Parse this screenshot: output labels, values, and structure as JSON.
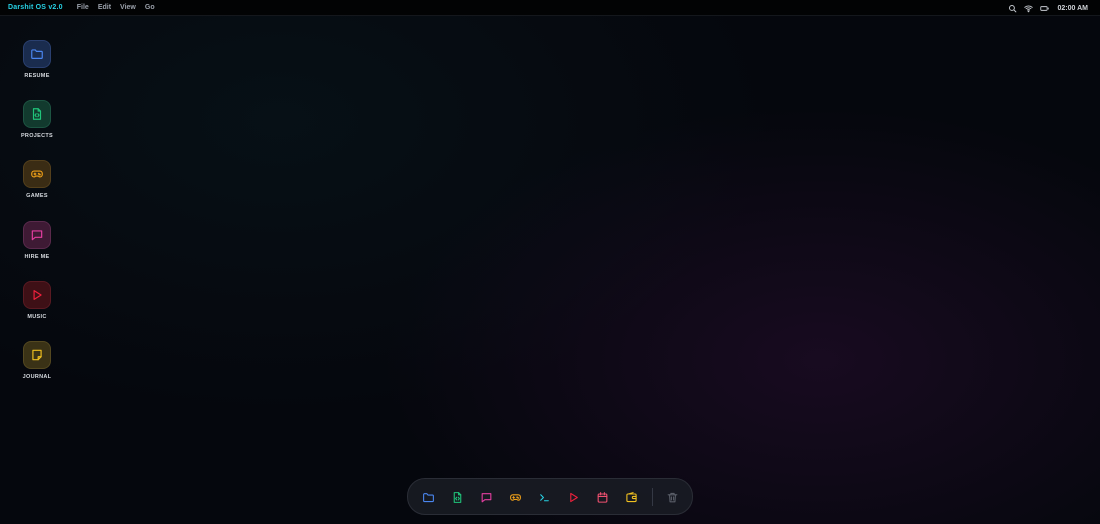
{
  "menubar": {
    "brand": "Darshit OS v2.0",
    "menu": [
      "File",
      "Edit",
      "View",
      "Go"
    ],
    "clock": "02:00 AM",
    "icons": [
      "search-icon",
      "wifi-icon",
      "battery-icon"
    ]
  },
  "desktop": {
    "icons": [
      {
        "label": "RESUME",
        "icon": "folder-icon",
        "color": "#4a86f0",
        "bg": "#1a2c4e"
      },
      {
        "label": "PROJECTS",
        "icon": "code-file-icon",
        "color": "#20c47a",
        "bg": "#123a2e"
      },
      {
        "label": "GAMES",
        "icon": "gamepad-icon",
        "color": "#f0a018",
        "bg": "#3a2c14"
      },
      {
        "label": "HIRE ME",
        "icon": "chat-icon",
        "color": "#e43ea0",
        "bg": "#3e1a34"
      },
      {
        "label": "MUSIC",
        "icon": "play-icon",
        "color": "#f0203c",
        "bg": "#3e1016"
      },
      {
        "label": "JOURNAL",
        "icon": "note-icon",
        "color": "#f0c020",
        "bg": "#3a3216"
      }
    ]
  },
  "dock": {
    "items": [
      {
        "icon": "folder-icon",
        "color": "#4a86f0"
      },
      {
        "icon": "code-file-icon",
        "color": "#20c47a"
      },
      {
        "icon": "chat-icon",
        "color": "#e43ea0"
      },
      {
        "icon": "gamepad-icon",
        "color": "#f0a018"
      },
      {
        "icon": "terminal-icon",
        "color": "#27d3e6"
      },
      {
        "icon": "play-icon",
        "color": "#f0203c"
      },
      {
        "icon": "calendar-icon",
        "color": "#f05070"
      },
      {
        "icon": "wallet-icon",
        "color": "#f0c020"
      }
    ],
    "trash": {
      "icon": "trash-icon",
      "color": "#5a5e68"
    }
  }
}
